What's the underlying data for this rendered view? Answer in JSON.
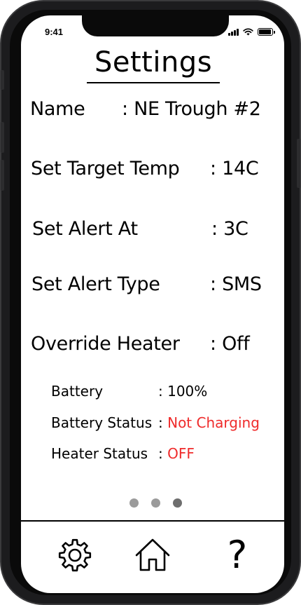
{
  "status_bar": {
    "time": "9:41"
  },
  "page": {
    "title": "Settings"
  },
  "settings": {
    "name_label": "Name",
    "name_value": ": NE Trough #2",
    "target_temp_label": "Set Target Temp",
    "target_temp_value": ": 14C",
    "alert_at_label": "Set Alert At",
    "alert_at_value": ":   3C",
    "alert_type_label": "Set Alert Type",
    "alert_type_value": ": SMS",
    "override_heater_label": "Override Heater",
    "override_heater_value": ":  Off"
  },
  "info": {
    "battery_label": "Battery",
    "battery_value": ": 100%",
    "battery_status_label": "Battery Status",
    "battery_status_prefix": ": ",
    "battery_status_value": "Not Charging",
    "heater_status_label": "Heater Status",
    "heater_status_prefix": ": ",
    "heater_status_value": "OFF"
  },
  "pager": {
    "page_count": 3,
    "active_index": 3
  },
  "tab_bar": {
    "items": [
      {
        "icon": "gear-icon"
      },
      {
        "icon": "home-icon"
      },
      {
        "icon": "question-mark-icon",
        "glyph": "?"
      }
    ]
  },
  "colors": {
    "alert_red": "#ef2b2b",
    "dot_inactive": "#9b9b9b",
    "dot_active": "#6e6e6e"
  }
}
